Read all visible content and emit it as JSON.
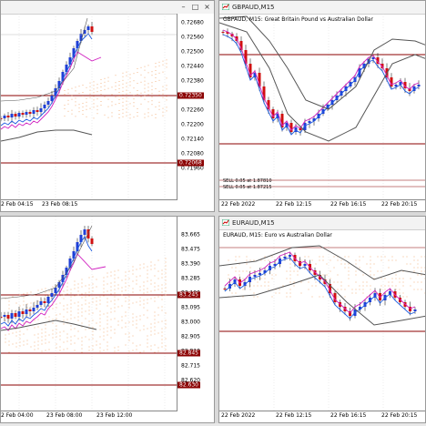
{
  "colors": {
    "bull": "#1f3fd6",
    "bear": "#d01010",
    "level": "#8b0000",
    "ichimoku": "#f0a060",
    "band": "#555555",
    "ma_blue": "#1e5be0",
    "ma_mag": "#d020c0"
  },
  "windows": {
    "top_left": {
      "title": "",
      "ylabels": [
        "0.72680",
        "0.72560",
        "0.72500",
        "0.72440",
        "0.72380",
        "0.72320",
        "0.72260",
        "0.72200",
        "0.72140",
        "0.72080",
        "0.71960"
      ],
      "ytag_upper": "0.72350",
      "ytag_lower": "0.72068",
      "xlabels": [
        "2 Feb 04:15",
        "23 Feb 08:15"
      ]
    },
    "top_right": {
      "title": "GBPAUD,M15",
      "info": "GBPAUD, M15: Great Britain Pound vs Australian Dollar",
      "sell1": "SELL 0.05 at 1.87810",
      "sell2": "SELL 0.05 at 1.87215",
      "xlabels": [
        "22 Feb 2022",
        "22 Feb 12:15",
        "22 Feb 16:15",
        "22 Feb 20:15"
      ]
    },
    "bottom_left": {
      "title": "",
      "ylabels": [
        "83.665",
        "83.475",
        "83.390",
        "83.285",
        "83.190",
        "83.095",
        "83.000",
        "82.905",
        "82.810",
        "82.715",
        "82.620"
      ],
      "ytag_upper": "83.245",
      "ytag_mid": "82.845",
      "ytag_lower": "82.630",
      "xlabels": [
        "2 Feb 04:00",
        "23 Feb 08:00",
        "23 Feb 12:00"
      ]
    },
    "bottom_right": {
      "title": "EURAUD,M15",
      "info": "EURAUD, M15: Euro vs Australian Dollar",
      "xlabels": [
        "22 Feb 2022",
        "22 Feb 12:15",
        "22 Feb 16:15",
        "22 Feb 20:15"
      ]
    }
  }
}
